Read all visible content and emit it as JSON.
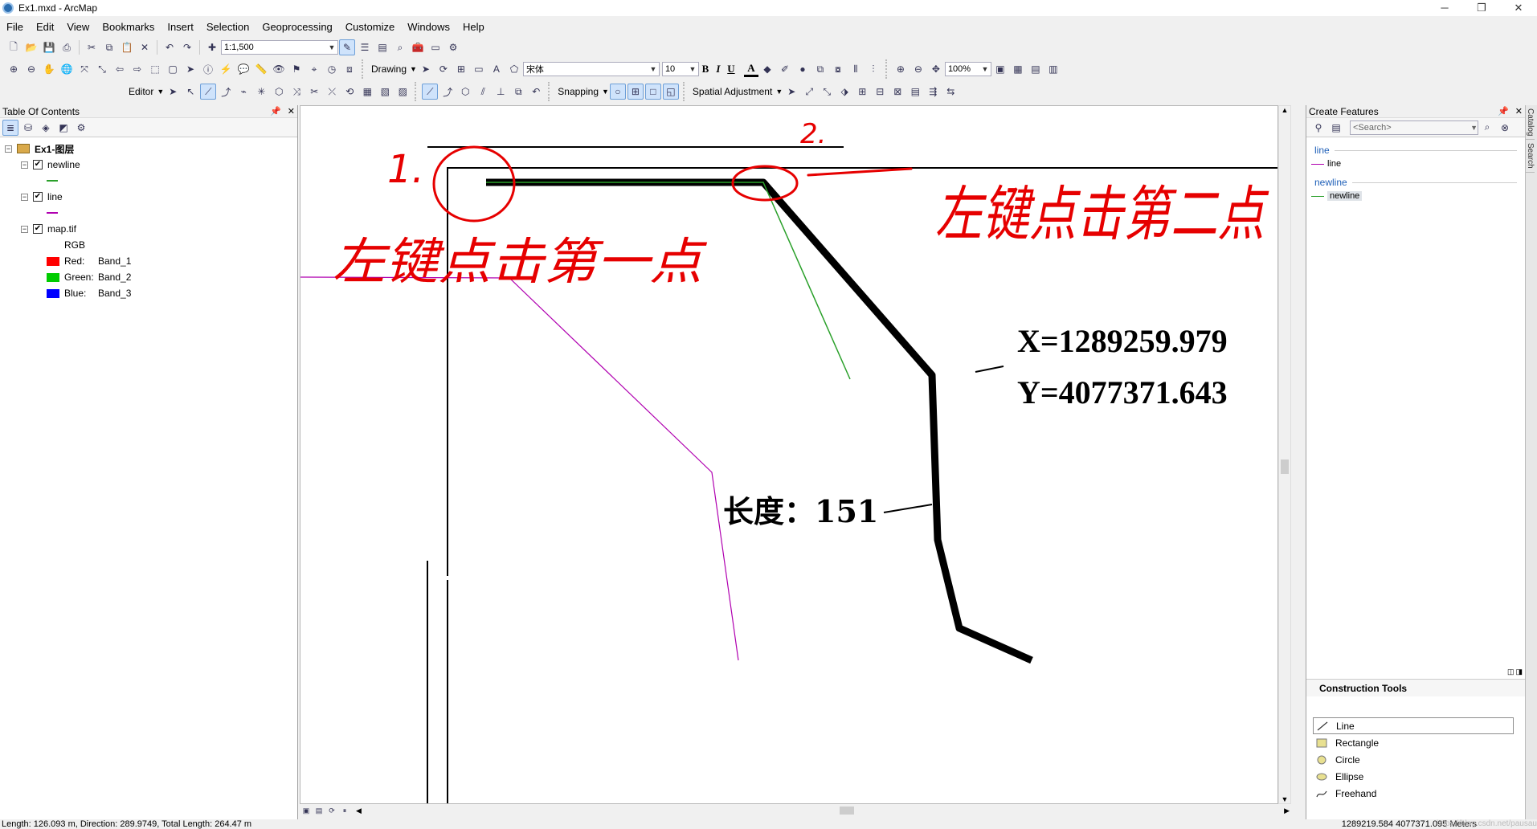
{
  "window": {
    "title": "Ex1.mxd - ArcMap",
    "controls": [
      "─",
      "❐",
      "✕"
    ]
  },
  "menu": [
    "File",
    "Edit",
    "View",
    "Bookmarks",
    "Insert",
    "Selection",
    "Geoprocessing",
    "Customize",
    "Windows",
    "Help"
  ],
  "toolbar": {
    "scale": "1:1,500",
    "drawing_label": "Drawing",
    "font": "宋体",
    "font_size": "10",
    "bold": "B",
    "italic": "I",
    "underline": "U",
    "font_color_glyph": "A",
    "zoom_pct": "100%",
    "editor_label": "Editor",
    "snapping_label": "Snapping",
    "spatial_adjustment_label": "Spatial Adjustment"
  },
  "toc": {
    "title": "Table Of Contents",
    "frame": "Ex1-图层",
    "layers": [
      {
        "name": "newline",
        "checked": true,
        "symbol_color": "#2aa02a"
      },
      {
        "name": "line",
        "checked": true,
        "symbol_color": "#b000b0"
      },
      {
        "name": "map.tif",
        "checked": true
      }
    ],
    "rgb_label": "RGB",
    "bands": [
      {
        "label": "Red:",
        "band": "Band_1",
        "color": "#ff0000"
      },
      {
        "label": "Green:",
        "band": "Band_2",
        "color": "#00cc00"
      },
      {
        "label": "Blue:",
        "band": "Band_3",
        "color": "#0000ff"
      }
    ]
  },
  "map": {
    "coord_x": "X=1289259.979",
    "coord_y": "Y=4077371.643",
    "length_label": "长度：151",
    "annotations": {
      "step1_num": "1.",
      "step1_text": "左键点击第一点",
      "step2_num": "2.",
      "step2_text": "左键点击第二点",
      "color": "#e60000"
    }
  },
  "create_features": {
    "title": "Create Features",
    "search_placeholder": "<Search>",
    "groups": [
      {
        "name": "line",
        "item": "line",
        "color": "#b000b0"
      },
      {
        "name": "newline",
        "item": "newline",
        "color": "#2aa02a"
      }
    ]
  },
  "construction_tools": {
    "title": "Construction Tools",
    "items": [
      "Line",
      "Rectangle",
      "Circle",
      "Ellipse",
      "Freehand"
    ],
    "selected": "Line"
  },
  "side_tabs": [
    "Catalog",
    "Search"
  ],
  "status": {
    "left": "Length: 126.093 m, Direction: 289.9749, Total Length: 264.47 m",
    "right": "1289219.584  4077371.095 Meters",
    "watermark": "https://blog.csdn.net/pausau"
  }
}
